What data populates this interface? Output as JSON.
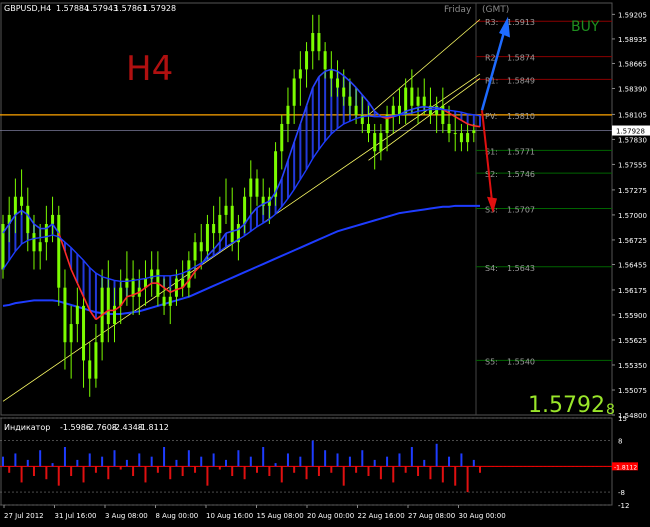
{
  "symbol_header": "GBPUSD,H4",
  "ohlc": [
    "1.57884",
    "1.57943",
    "1.57861",
    "1.57928"
  ],
  "timeframe_label": "H4",
  "session_label": "Friday",
  "gmt_label": "(GMT)",
  "buy_label": "BUY",
  "current_price": {
    "main": "1.5792",
    "suffix": "8"
  },
  "colors": {
    "background": "#000000",
    "grid": "#3a3a3a",
    "candles": "#7CFC00",
    "ma_fast_down": "#ff2a2a",
    "ma_slow": "#1e3cff",
    "ma_long": "#1e3cff",
    "trendline": "#ffff66",
    "pivot": "#ffa500",
    "resistance": "#8b0000",
    "support": "#006400",
    "buy_arrow": "#1e6bff",
    "sell_arrow": "#e01010",
    "osc_up": "#1e3cff",
    "osc_down": "#e01010",
    "last_price": "#ff0000"
  },
  "indicator_panel": {
    "title": "Индикатор",
    "values": [
      "-1.5986",
      "-2.7608",
      "-2.4348",
      "-1.8112"
    ],
    "last_value_tag": "-1.8112"
  },
  "chart_data": [
    {
      "type": "line",
      "title": "GBPUSD,H4",
      "price_axis_ticks": [
        "1.59205",
        "1.58935",
        "1.58665",
        "1.58390",
        "1.58105",
        "1.57830",
        "1.57555",
        "1.57275",
        "1.57000",
        "1.56725",
        "1.56455",
        "1.56175",
        "1.55900",
        "1.55625",
        "1.55350",
        "1.55075",
        "1.54800"
      ],
      "time_axis_ticks": [
        "27 Jul 2012",
        "31 Jul 16:00",
        "3 Aug 08:00",
        "8 Aug 00:00",
        "10 Aug 16:00",
        "15 Aug 08:00",
        "20 Aug 00:00",
        "22 Aug 16:00",
        "27 Aug 08:00",
        "30 Aug 00:00"
      ],
      "ylim": [
        1.548,
        1.5933
      ],
      "last_price_tag": "1.57928",
      "pivot_levels": [
        {
          "name": "R3",
          "value": 1.5913
        },
        {
          "name": "R2",
          "value": 1.5874
        },
        {
          "name": "R1",
          "value": 1.5849
        },
        {
          "name": "PV",
          "value": 1.581
        },
        {
          "name": "S1",
          "value": 1.5771
        },
        {
          "name": "S2",
          "value": 1.5746
        },
        {
          "name": "S3",
          "value": 1.5707
        },
        {
          "name": "S4",
          "value": 1.5643
        },
        {
          "name": "S5",
          "value": 1.554
        }
      ],
      "bars_x_range": [
        1,
        78
      ],
      "series": [
        {
          "type": "candlestick",
          "ohlc": [
            [
              1.564,
              1.57,
              1.563,
              1.569
            ],
            [
              1.569,
              1.572,
              1.567,
              1.57
            ],
            [
              1.57,
              1.574,
              1.568,
              1.572
            ],
            [
              1.572,
              1.575,
              1.57,
              1.571
            ],
            [
              1.571,
              1.573,
              1.566,
              1.568
            ],
            [
              1.568,
              1.57,
              1.564,
              1.566
            ],
            [
              1.566,
              1.569,
              1.564,
              1.567
            ],
            [
              1.567,
              1.571,
              1.565,
              1.569
            ],
            [
              1.569,
              1.572,
              1.567,
              1.57
            ],
            [
              1.57,
              1.571,
              1.56,
              1.562
            ],
            [
              1.562,
              1.564,
              1.553,
              1.556
            ],
            [
              1.556,
              1.56,
              1.552,
              1.558
            ],
            [
              1.558,
              1.562,
              1.556,
              1.56
            ],
            [
              1.56,
              1.561,
              1.551,
              1.554
            ],
            [
              1.554,
              1.556,
              1.55,
              1.552
            ],
            [
              1.552,
              1.558,
              1.551,
              1.556
            ],
            [
              1.556,
              1.564,
              1.554,
              1.562
            ],
            [
              1.562,
              1.565,
              1.556,
              1.558
            ],
            [
              1.558,
              1.562,
              1.556,
              1.56
            ],
            [
              1.56,
              1.564,
              1.558,
              1.562
            ],
            [
              1.562,
              1.566,
              1.56,
              1.563
            ],
            [
              1.563,
              1.565,
              1.559,
              1.561
            ],
            [
              1.561,
              1.564,
              1.559,
              1.562
            ],
            [
              1.562,
              1.565,
              1.56,
              1.563
            ],
            [
              1.563,
              1.566,
              1.561,
              1.564
            ],
            [
              1.564,
              1.566,
              1.56,
              1.561
            ],
            [
              1.561,
              1.563,
              1.559,
              1.56
            ],
            [
              1.56,
              1.562,
              1.558,
              1.561
            ],
            [
              1.561,
              1.564,
              1.56,
              1.563
            ],
            [
              1.563,
              1.565,
              1.561,
              1.562
            ],
            [
              1.562,
              1.566,
              1.561,
              1.565
            ],
            [
              1.565,
              1.568,
              1.563,
              1.567
            ],
            [
              1.567,
              1.569,
              1.564,
              1.566
            ],
            [
              1.566,
              1.57,
              1.565,
              1.569
            ],
            [
              1.569,
              1.571,
              1.566,
              1.568
            ],
            [
              1.568,
              1.572,
              1.567,
              1.57
            ],
            [
              1.57,
              1.574,
              1.569,
              1.571
            ],
            [
              1.571,
              1.573,
              1.566,
              1.567
            ],
            [
              1.567,
              1.57,
              1.565,
              1.569
            ],
            [
              1.569,
              1.573,
              1.568,
              1.572
            ],
            [
              1.572,
              1.576,
              1.57,
              1.574
            ],
            [
              1.574,
              1.575,
              1.571,
              1.572
            ],
            [
              1.572,
              1.574,
              1.57,
              1.571
            ],
            [
              1.571,
              1.573,
              1.569,
              1.572
            ],
            [
              1.572,
              1.578,
              1.571,
              1.577
            ],
            [
              1.577,
              1.581,
              1.575,
              1.58
            ],
            [
              1.58,
              1.584,
              1.578,
              1.582
            ],
            [
              1.582,
              1.586,
              1.58,
              1.585
            ],
            [
              1.585,
              1.588,
              1.582,
              1.586
            ],
            [
              1.586,
              1.589,
              1.584,
              1.588
            ],
            [
              1.588,
              1.592,
              1.586,
              1.59
            ],
            [
              1.59,
              1.592,
              1.587,
              1.588
            ],
            [
              1.588,
              1.589,
              1.585,
              1.586
            ],
            [
              1.586,
              1.588,
              1.583,
              1.585
            ],
            [
              1.585,
              1.587,
              1.583,
              1.584
            ],
            [
              1.584,
              1.586,
              1.582,
              1.583
            ],
            [
              1.583,
              1.585,
              1.581,
              1.582
            ],
            [
              1.582,
              1.584,
              1.58,
              1.581
            ],
            [
              1.581,
              1.583,
              1.579,
              1.58
            ],
            [
              1.58,
              1.582,
              1.578,
              1.579
            ],
            [
              1.579,
              1.58,
              1.575,
              1.577
            ],
            [
              1.577,
              1.58,
              1.576,
              1.579
            ],
            [
              1.579,
              1.582,
              1.577,
              1.581
            ],
            [
              1.581,
              1.583,
              1.579,
              1.582
            ],
            [
              1.582,
              1.584,
              1.58,
              1.581
            ],
            [
              1.581,
              1.585,
              1.58,
              1.584
            ],
            [
              1.584,
              1.586,
              1.581,
              1.582
            ],
            [
              1.582,
              1.584,
              1.58,
              1.583
            ],
            [
              1.583,
              1.585,
              1.581,
              1.582
            ],
            [
              1.582,
              1.584,
              1.58,
              1.581
            ],
            [
              1.581,
              1.583,
              1.579,
              1.582
            ],
            [
              1.582,
              1.584,
              1.579,
              1.58
            ],
            [
              1.58,
              1.582,
              1.578,
              1.579
            ],
            [
              1.579,
              1.581,
              1.577,
              1.579
            ],
            [
              1.579,
              1.58,
              1.577,
              1.578
            ],
            [
              1.578,
              1.58,
              1.577,
              1.579
            ],
            [
              1.579,
              1.58,
              1.578,
              1.5793
            ]
          ]
        },
        {
          "type": "ma_fast",
          "values": [
            1.568,
            1.569,
            1.57,
            1.5705,
            1.57,
            1.569,
            1.5685,
            1.5685,
            1.569,
            1.568,
            1.566,
            1.564,
            1.5625,
            1.561,
            1.5595,
            1.5585,
            1.559,
            1.5595,
            1.5595,
            1.56,
            1.561,
            1.5612,
            1.5615,
            1.562,
            1.5625,
            1.5625,
            1.562,
            1.5615,
            1.5618,
            1.562,
            1.5628,
            1.5638,
            1.5645,
            1.5655,
            1.5662,
            1.567,
            1.568,
            1.5682,
            1.5684,
            1.569,
            1.57,
            1.5708,
            1.5712,
            1.5715,
            1.5725,
            1.574,
            1.576,
            1.578,
            1.58,
            1.582,
            1.584,
            1.5852,
            1.5858,
            1.586,
            1.5858,
            1.5853,
            1.5847,
            1.584,
            1.5832,
            1.5824,
            1.5814,
            1.5808,
            1.5806,
            1.5808,
            1.581,
            1.5814,
            1.5816,
            1.5818,
            1.5819,
            1.5818,
            1.5818,
            1.5816,
            1.5812,
            1.5808,
            1.5804,
            1.58,
            1.5798,
            1.5797
          ]
        },
        {
          "type": "ma_slow",
          "values": [
            1.564,
            1.565,
            1.566,
            1.5668,
            1.5672,
            1.5674,
            1.5675,
            1.5676,
            1.5678,
            1.5676,
            1.567,
            1.5664,
            1.5657,
            1.565,
            1.5642,
            1.5636,
            1.5632,
            1.563,
            1.5628,
            1.5627,
            1.5627,
            1.5628,
            1.5629,
            1.563,
            1.5632,
            1.5633,
            1.5633,
            1.5633,
            1.5634,
            1.5636,
            1.5639,
            1.5643,
            1.5647,
            1.5651,
            1.5655,
            1.566,
            1.5665,
            1.5669,
            1.5673,
            1.5677,
            1.5682,
            1.5687,
            1.5691,
            1.5695,
            1.5701,
            1.5709,
            1.5718,
            1.5728,
            1.5739,
            1.575,
            1.5762,
            1.5772,
            1.5781,
            1.5789,
            1.5795,
            1.58,
            1.5803,
            1.5806,
            1.5808,
            1.5809,
            1.5808,
            1.5808,
            1.5808,
            1.5809,
            1.581,
            1.5811,
            1.5812,
            1.5814,
            1.5815,
            1.5816,
            1.5816,
            1.5816,
            1.5815,
            1.5814,
            1.5813,
            1.5811,
            1.581,
            1.5809
          ]
        },
        {
          "type": "ma_long",
          "values": [
            1.56,
            1.5601,
            1.5603,
            1.5604,
            1.5605,
            1.5606,
            1.5606,
            1.5606,
            1.5606,
            1.5605,
            1.5603,
            1.5601,
            1.5599,
            1.5597,
            1.5595,
            1.5593,
            1.5592,
            1.5591,
            1.5591,
            1.5591,
            1.5592,
            1.5593,
            1.5594,
            1.5596,
            1.5598,
            1.56,
            1.5602,
            1.5604,
            1.5606,
            1.5608,
            1.561,
            1.5613,
            1.5616,
            1.5619,
            1.5622,
            1.5625,
            1.5628,
            1.5631,
            1.5634,
            1.5637,
            1.564,
            1.5643,
            1.5646,
            1.5649,
            1.5652,
            1.5655,
            1.5658,
            1.5661,
            1.5664,
            1.5667,
            1.567,
            1.5673,
            1.5676,
            1.5679,
            1.5682,
            1.5684,
            1.5686,
            1.5688,
            1.569,
            1.5692,
            1.5694,
            1.5696,
            1.5698,
            1.57,
            1.5702,
            1.5703,
            1.5704,
            1.5705,
            1.5706,
            1.5707,
            1.5708,
            1.5709,
            1.5709,
            1.571,
            1.571,
            1.571,
            1.571,
            1.571
          ]
        }
      ],
      "trendlines": [
        {
          "from": [
            1,
            1.5495
          ],
          "to": [
            78,
            1.5855
          ]
        },
        {
          "from": [
            60,
            1.576
          ],
          "to": [
            78,
            1.585
          ]
        },
        {
          "from": [
            60,
            1.581
          ],
          "to": [
            78,
            1.5915
          ]
        }
      ]
    },
    {
      "type": "bar",
      "title": "Индикатор",
      "ylim": [
        -12,
        15
      ],
      "ticks": [
        "15",
        "8",
        "0",
        "-8",
        "-12"
      ],
      "values": [
        3,
        -2,
        4,
        -5,
        2,
        -3,
        5,
        -4,
        1,
        -6,
        6,
        -3,
        2,
        -5,
        4,
        -2,
        3,
        -4,
        5,
        -1,
        2,
        -3,
        4,
        -5,
        3,
        -2,
        6,
        -4,
        2,
        -3,
        5,
        -2,
        3,
        -6,
        4,
        -1,
        2,
        -3,
        5,
        -4,
        3,
        -2,
        6,
        -3,
        1,
        -5,
        4,
        -2,
        3,
        -4,
        8,
        -3,
        5,
        -2,
        4,
        -6,
        3,
        -2,
        5,
        -3,
        2,
        -4,
        3,
        -5,
        4,
        -2,
        6,
        -3,
        2,
        -4,
        7,
        -5,
        3,
        -6,
        4,
        -8,
        2,
        -2
      ]
    }
  ]
}
